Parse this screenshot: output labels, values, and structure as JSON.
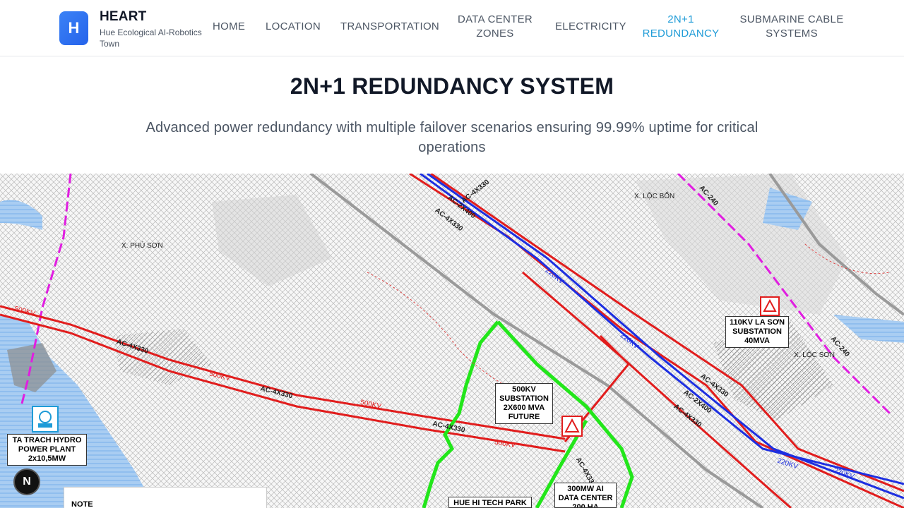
{
  "header": {
    "logo_letter": "H",
    "brand_name": "HEART",
    "brand_subtitle": "Hue Ecological AI-Robotics Town",
    "nav": [
      {
        "label": "HOME",
        "active": false
      },
      {
        "label": "LOCATION",
        "active": false
      },
      {
        "label": "TRANSPORTATION",
        "active": false
      },
      {
        "label": "DATA CENTER ZONES",
        "active": false
      },
      {
        "label": "ELECTRICITY",
        "active": false
      },
      {
        "label": "2N+1 REDUNDANCY",
        "active": true
      },
      {
        "label": "SUBMARINE CABLE SYSTEMS",
        "active": false
      }
    ]
  },
  "main": {
    "title": "2N+1 REDUNDANCY SYSTEM",
    "subtitle": "Advanced power redundancy with multiple failover scenarios ensuring 99.99% uptime for critical operations"
  },
  "map": {
    "labels": {
      "substation_500kv": "500KV SUBSTATION 2X600 MVA FUTURE",
      "substation_110kv": "110KV LA SƠN SUBSTATION 40MVA",
      "hydro": "TA TRACH HYDRO POWER PLANT 2x10,5MW",
      "data_center": "300MW AI DATA CENTER 200 HA",
      "tech_park": "HUE HI TECH PARK",
      "note": "NOTE"
    },
    "places": {
      "phu_son": "X. PHÚ SƠN",
      "loc_bon": "X. LỘC BỔN",
      "loc_son": "X. LỘC SƠN"
    },
    "line_labels": {
      "ac4x330": "AC-4X330",
      "ac2x400": "AC-2X400",
      "ac240": "AC-240",
      "kv500": "500KV",
      "kv220": "220KV"
    },
    "badge": "N",
    "colors": {
      "line_500kv": "#e11d1d",
      "line_220kv": "#1d2fe1",
      "route_green": "#22e61a",
      "line_magenta": "#e01ee0",
      "water": "#6aa8e8"
    }
  }
}
